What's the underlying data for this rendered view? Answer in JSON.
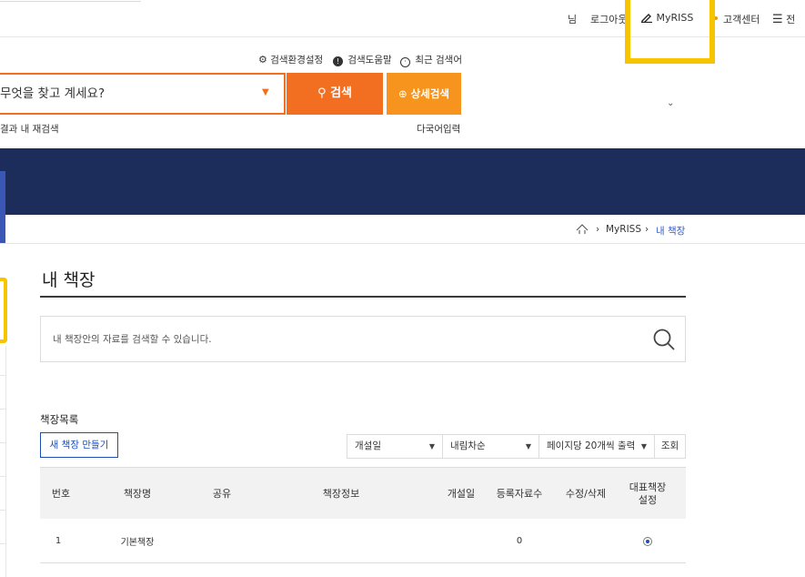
{
  "topbar": {
    "user_suffix": "님",
    "logout": "로그아웃",
    "myriss": "MyRISS",
    "customer_center": "고객센터",
    "all_menu": "전"
  },
  "search_utils": {
    "settings": "검색환경설정",
    "help": "검색도움말",
    "recent": "최근 검색어"
  },
  "search": {
    "placeholder": "무엇을 찾고 계세요?",
    "button": "검색",
    "advanced": "상세검색",
    "within_results": "결과 내 재검색",
    "multilingual": "다국어입력"
  },
  "breadcrumb": {
    "myriss": "MyRISS",
    "current": "내 책장"
  },
  "page": {
    "title": "내 책장",
    "search_placeholder": "내 책장안의 자료를 검색할 수 있습니다.",
    "section_label": "책장목록",
    "new_button": "새 책장 만들기"
  },
  "filters": {
    "sort_field": "개설일",
    "sort_order": "내림차순",
    "per_page": "페이지당 20개씩 출력",
    "view_button": "조회"
  },
  "table": {
    "headers": [
      "번호",
      "책장명",
      "공유",
      "책장정보",
      "개설일",
      "등록자료수",
      "수정/삭제",
      "대표책장\n설정"
    ],
    "rows": [
      {
        "num": "1",
        "name": "기본책장",
        "share": "",
        "info": "",
        "date": "",
        "count": "0",
        "edit": "",
        "default": true
      }
    ]
  },
  "colors": {
    "accent_orange": "#f26f21",
    "accent_orange_light": "#f7941d",
    "navy": "#1d2d5b",
    "highlight_yellow": "#f7c500",
    "link_blue": "#1d4fb2"
  }
}
